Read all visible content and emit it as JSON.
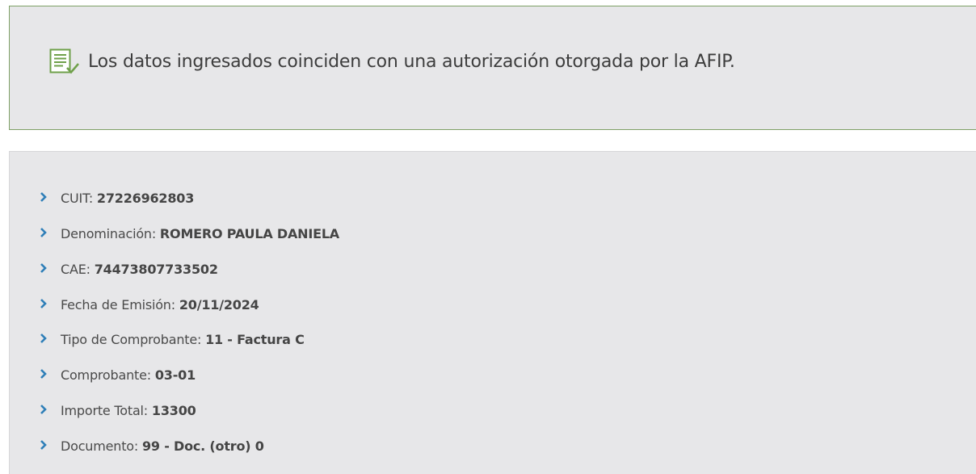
{
  "alert": {
    "message": "Los datos ingresados coinciden con una autorización otorgada por la AFIP.",
    "icon": "document-check-icon",
    "colors": {
      "border": "#7fa066",
      "icon": "#6fa04a",
      "background": "#e7e7e9"
    }
  },
  "details": {
    "items": [
      {
        "label": "CUIT: ",
        "value": "27226962803"
      },
      {
        "label": "Denominación: ",
        "value": "ROMERO PAULA DANIELA"
      },
      {
        "label": "CAE: ",
        "value": "74473807733502"
      },
      {
        "label": "Fecha de Emisión: ",
        "value": "20/11/2024"
      },
      {
        "label": "Tipo de Comprobante: ",
        "value": "11 - Factura C"
      },
      {
        "label": "Comprobante: ",
        "value": "03-01"
      },
      {
        "label": "Importe Total: ",
        "value": "13300"
      },
      {
        "label": "Documento: ",
        "value": "99 - Doc. (otro) 0"
      }
    ],
    "bullet_icon": "chevron-right-icon",
    "colors": {
      "bullet": "#2f7fb8",
      "text": "#4a4a4a"
    }
  }
}
